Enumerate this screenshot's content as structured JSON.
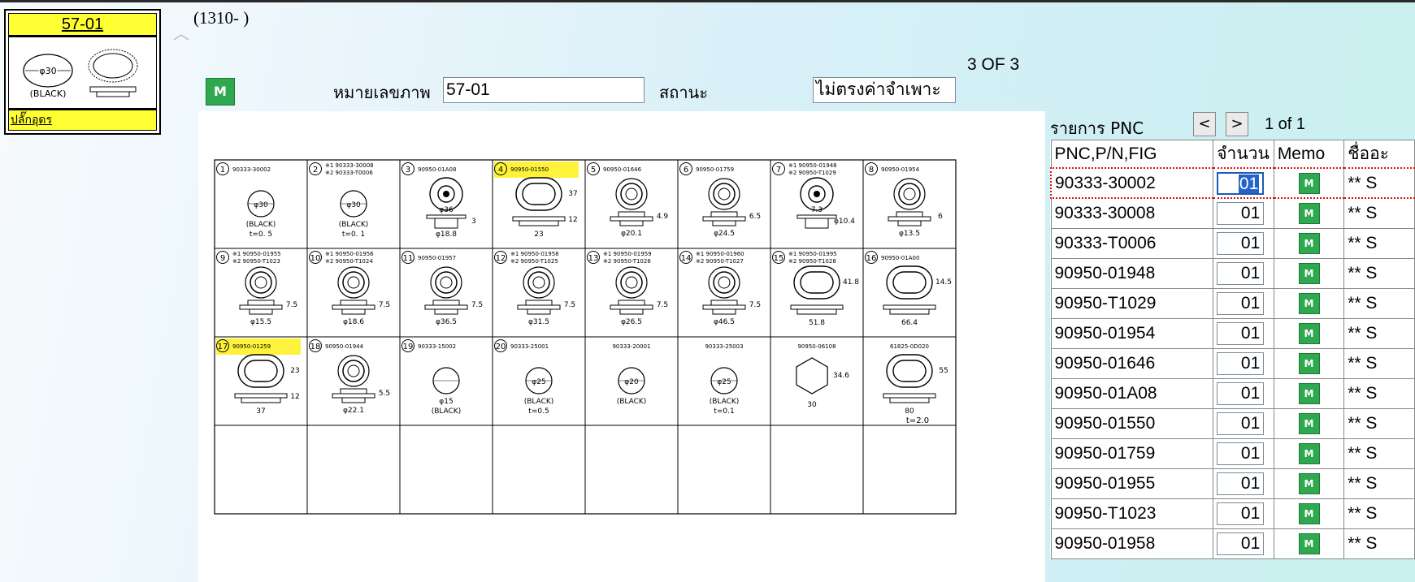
{
  "thumbnail": {
    "title": "57-01",
    "label": "ปลั๊กอุดร",
    "dim_text": "φ30",
    "color_text": "(BLACK)"
  },
  "caption": "(1310-    )",
  "page_count": "3 OF  3",
  "header": {
    "fig_label": "หมายเลขภาพ",
    "fig_value": "57-01",
    "status_label": "สถานะ",
    "status_value": "ไม่ตรงค่าจำเพาะ",
    "memo_icon": "M"
  },
  "pnc": {
    "title": "รายการ PNC",
    "prev": "<",
    "next": ">",
    "page": "1 of 1",
    "columns": [
      "PNC,P/N,FIG",
      "จำนวน",
      "Memo",
      "ชื่ออะ"
    ],
    "rows": [
      {
        "pn": "90333-30002",
        "qty": "01",
        "name": "** S"
      },
      {
        "pn": "90333-30008",
        "qty": "01",
        "name": "** S"
      },
      {
        "pn": "90333-T0006",
        "qty": "01",
        "name": "** S"
      },
      {
        "pn": "90950-01948",
        "qty": "01",
        "name": "** S"
      },
      {
        "pn": "90950-T1029",
        "qty": "01",
        "name": "** S"
      },
      {
        "pn": "90950-01954",
        "qty": "01",
        "name": "** S"
      },
      {
        "pn": "90950-01646",
        "qty": "01",
        "name": "** S"
      },
      {
        "pn": "90950-01A08",
        "qty": "01",
        "name": "** S"
      },
      {
        "pn": "90950-01550",
        "qty": "01",
        "name": "** S"
      },
      {
        "pn": "90950-01759",
        "qty": "01",
        "name": "** S"
      },
      {
        "pn": "90950-01955",
        "qty": "01",
        "name": "** S"
      },
      {
        "pn": "90950-T1023",
        "qty": "01",
        "name": "** S"
      },
      {
        "pn": "90950-01958",
        "qty": "01",
        "name": "** S"
      }
    ]
  },
  "diagram": {
    "cells": [
      {
        "no": "1",
        "p1": "90333-30002",
        "p2": "",
        "hl": false,
        "shape": "ring",
        "dims": [
          "φ30",
          "(BLACK)",
          "t=0. 5"
        ]
      },
      {
        "no": "2",
        "p1": "※1 90333-30008",
        "p2": "※2 90333-T0006",
        "hl": false,
        "shape": "ring",
        "dims": [
          "φ30",
          "(BLACK)",
          "t=0. 1"
        ]
      },
      {
        "no": "3",
        "p1": "90950-01A08",
        "p2": "",
        "hl": false,
        "shape": "clip",
        "dims": [
          "φ36",
          "3",
          "φ18.8"
        ]
      },
      {
        "no": "4",
        "p1": "90950-01550",
        "p2": "",
        "hl": true,
        "shape": "oval",
        "dims": [
          "37",
          "12",
          "23"
        ]
      },
      {
        "no": "5",
        "p1": "90950-01646",
        "p2": "",
        "hl": false,
        "shape": "grommet",
        "dims": [
          "4.9",
          "φ20.1"
        ]
      },
      {
        "no": "6",
        "p1": "90950-01759",
        "p2": "",
        "hl": false,
        "shape": "grommet",
        "dims": [
          "6.5",
          "φ24.5"
        ]
      },
      {
        "no": "7",
        "p1": "※1 90950-01948",
        "p2": "※2 90950-T1029",
        "hl": false,
        "shape": "clip",
        "dims": [
          "7.3",
          "φ10.4"
        ]
      },
      {
        "no": "8",
        "p1": "90950-01954",
        "p2": "",
        "hl": false,
        "shape": "grommet",
        "dims": [
          "6",
          "φ13.5"
        ]
      },
      {
        "no": "9",
        "p1": "※1 90950-01955",
        "p2": "※2 90950-T1023",
        "hl": false,
        "shape": "grommet",
        "dims": [
          "7.5",
          "φ15.5"
        ]
      },
      {
        "no": "10",
        "p1": "※1 90950-01956",
        "p2": "※2 90950-T1024",
        "hl": false,
        "shape": "grommet",
        "dims": [
          "7.5",
          "φ18.6"
        ]
      },
      {
        "no": "11",
        "p1": "90950-01957",
        "p2": "",
        "hl": false,
        "shape": "grommet",
        "dims": [
          "7.5",
          "φ36.5"
        ]
      },
      {
        "no": "12",
        "p1": "※1 90950-01958",
        "p2": "※2 90950-T1025",
        "hl": false,
        "shape": "grommet",
        "dims": [
          "7.5",
          "φ31.5"
        ]
      },
      {
        "no": "13",
        "p1": "※1 90950-01959",
        "p2": "※2 90950-T1026",
        "hl": false,
        "shape": "grommet",
        "dims": [
          "7.5",
          "φ26.5"
        ]
      },
      {
        "no": "14",
        "p1": "※1 90950-01960",
        "p2": "※2 90950-T1027",
        "hl": false,
        "shape": "grommet",
        "dims": [
          "7.5",
          "φ46.5"
        ]
      },
      {
        "no": "15",
        "p1": "※1 90950-01995",
        "p2": "※2 90950-T1028",
        "hl": false,
        "shape": "oval",
        "dims": [
          "41.8",
          "",
          "51.8"
        ]
      },
      {
        "no": "16",
        "p1": "90950-01A00",
        "p2": "",
        "hl": false,
        "shape": "oval",
        "dims": [
          "14.5",
          "",
          "66.4"
        ]
      },
      {
        "no": "17",
        "p1": "90950-01259",
        "p2": "",
        "hl": true,
        "shape": "oval",
        "dims": [
          "23",
          "12",
          "37"
        ]
      },
      {
        "no": "18",
        "p1": "90950-01944",
        "p2": "",
        "hl": false,
        "shape": "grommet",
        "dims": [
          "5.5",
          "φ22.1"
        ]
      },
      {
        "no": "19",
        "p1": "90333-15002",
        "p2": "",
        "hl": false,
        "shape": "ring",
        "dims": [
          "",
          "φ15",
          "(BLACK)"
        ]
      },
      {
        "no": "20",
        "p1": "90333-25001",
        "p2": "",
        "hl": false,
        "shape": "ring",
        "dims": [
          "φ25",
          "(BLACK)",
          "t=0.5"
        ]
      },
      {
        "no": "",
        "p1": "90333-20001",
        "p2": "",
        "hl": false,
        "shape": "ring",
        "dims": [
          "φ20",
          "(BLACK)",
          ""
        ]
      },
      {
        "no": "",
        "p1": "90333-25003",
        "p2": "",
        "hl": false,
        "shape": "ring",
        "dims": [
          "φ25",
          "(BLACK)",
          "t=0.1"
        ]
      },
      {
        "no": "",
        "p1": "90950-06108",
        "p2": "",
        "hl": false,
        "shape": "hex",
        "dims": [
          "34.6",
          "",
          "30"
        ]
      },
      {
        "no": "",
        "p1": "61825-0D020",
        "p2": "",
        "hl": false,
        "shape": "oval",
        "dims": [
          "55",
          "",
          "80",
          "t=2.0"
        ]
      }
    ]
  }
}
